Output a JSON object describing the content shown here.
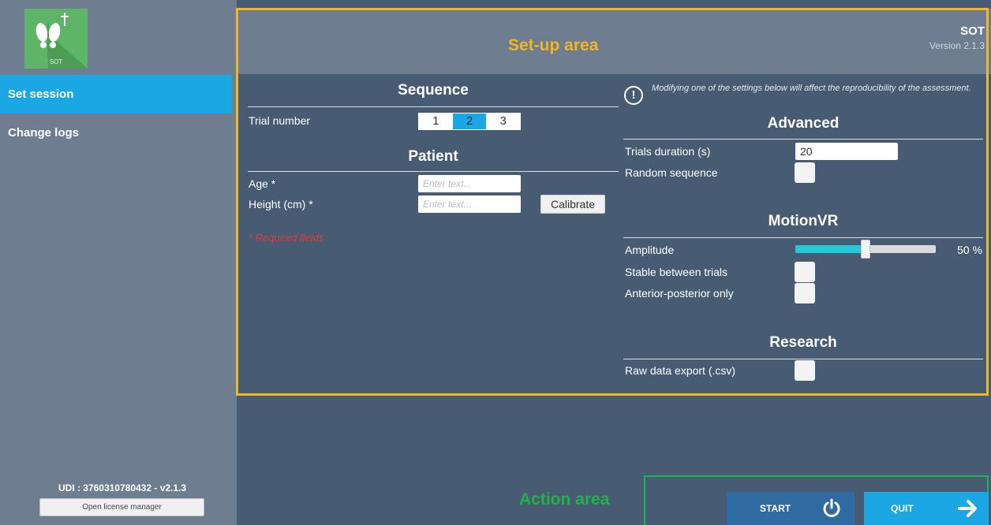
{
  "sidebar": {
    "logo_label": "SOT",
    "items": [
      {
        "label": "Set session",
        "active": true
      },
      {
        "label": "Change logs",
        "active": false
      }
    ],
    "udi": "UDI : 3760310780432 - v2.1.3",
    "license_button": "Open license manager"
  },
  "header": {
    "title": "SOT",
    "version": "Version 2.1.3"
  },
  "annotations": {
    "setup_area": "Set-up area",
    "action_area": "Action area"
  },
  "sequence": {
    "title": "Sequence",
    "trial_label": "Trial number",
    "trial_options": [
      "1",
      "2",
      "3"
    ],
    "trial_selected": "2"
  },
  "patient": {
    "title": "Patient",
    "age_label": "Age *",
    "age_placeholder": "Enter text...",
    "height_label": "Height (cm) *",
    "height_placeholder": "Enter text...",
    "calibrate_label": "Calibrate",
    "required_note": "* Required fields"
  },
  "warning": {
    "text": "Modifying one of the settings below will affect the reproducibility of the assessment."
  },
  "advanced": {
    "title": "Advanced",
    "duration_label": "Trials duration (s)",
    "duration_value": "20",
    "random_label": "Random sequence",
    "random_checked": false
  },
  "motionvr": {
    "title": "MotionVR",
    "amplitude_label": "Amplitude",
    "amplitude_value": 50,
    "amplitude_text": "50 %",
    "stable_label": "Stable between trials",
    "stable_checked": false,
    "ap_label": "Anterior-posterior only",
    "ap_checked": false
  },
  "research": {
    "title": "Research",
    "raw_label": "Raw data export (.csv)",
    "raw_checked": false
  },
  "actions": {
    "start_label": "START",
    "quit_label": "QUIT"
  },
  "colors": {
    "sidebar": "#6e7d8f",
    "main": "#475b72",
    "accent": "#1aa7e3",
    "setup_frame": "#f2b623",
    "action_frame": "#22b24c",
    "slider_fill": "#23c9d6",
    "required": "#e23b3b"
  },
  "icons": {
    "logo": "feet-logo-icon",
    "warning": "exclamation-circle-icon",
    "start": "power-icon",
    "quit": "arrow-right-icon"
  }
}
